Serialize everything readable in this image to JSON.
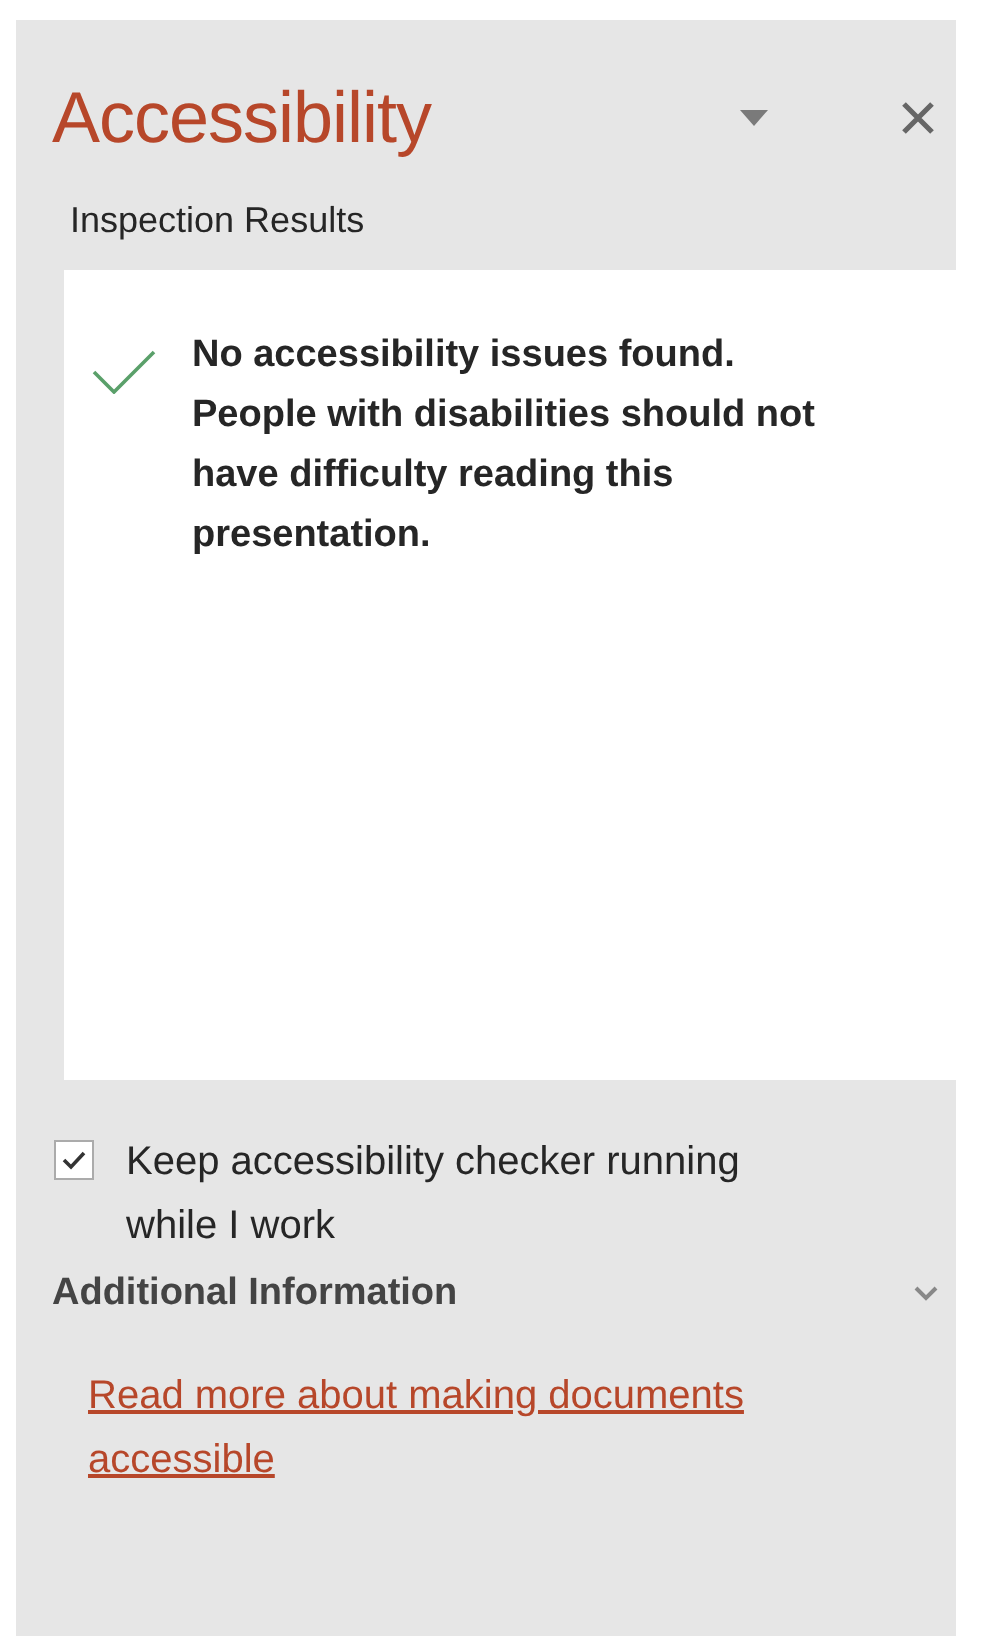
{
  "pane": {
    "title": "Accessibility"
  },
  "section_label": "Inspection Results",
  "result": {
    "message": "No accessibility issues found. People with disabilities should not have difficulty reading this presentation."
  },
  "option": {
    "label": "Keep accessibility checker running while I work",
    "checked": true
  },
  "additional_information": {
    "heading": "Additional Information",
    "link": "Read more about making documents accessible"
  }
}
